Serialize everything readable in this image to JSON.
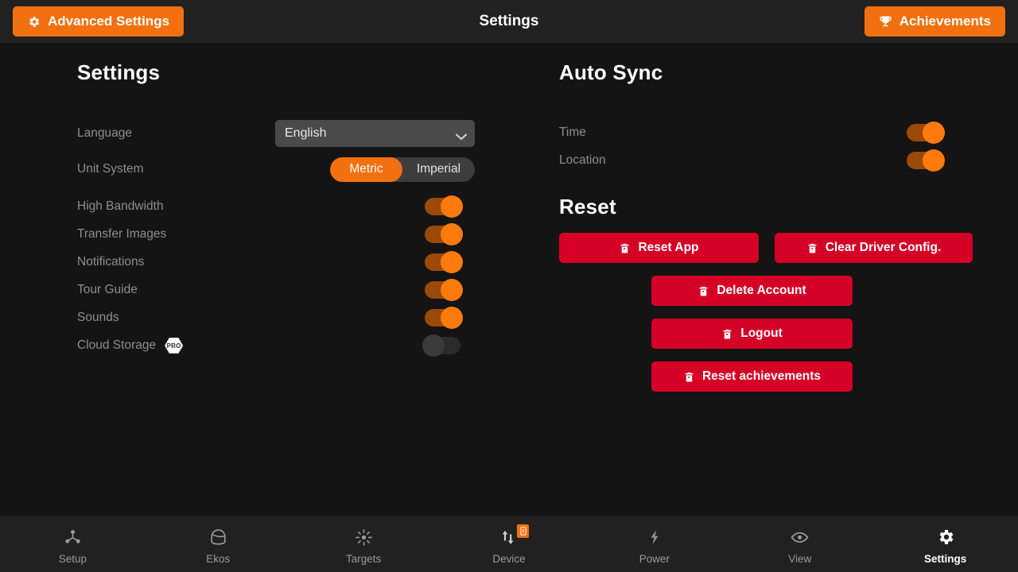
{
  "header": {
    "title": "Settings",
    "advanced_settings_label": "Advanced Settings",
    "advanced_settings_icon": "gear-icon",
    "achievements_label": "Achievements",
    "achievements_icon": "trophy-icon",
    "accent_color": "#f2700f",
    "background": "#212121"
  },
  "settings_section": {
    "title": "Settings",
    "language": {
      "label": "Language",
      "value": "English",
      "chevron_icon": "chevron-down-icon"
    },
    "unit_system": {
      "label": "Unit System",
      "options": [
        "Metric",
        "Imperial"
      ],
      "selected": "Metric"
    },
    "toggles": [
      {
        "label": "High Bandwidth",
        "state": "on"
      },
      {
        "label": "Transfer Images",
        "state": "on"
      },
      {
        "label": "Notifications",
        "state": "on"
      },
      {
        "label": "Tour Guide",
        "state": "on"
      },
      {
        "label": "Sounds",
        "state": "on"
      },
      {
        "label": "Cloud Storage",
        "state": "off",
        "badge": "PRO"
      }
    ]
  },
  "auto_sync_section": {
    "title": "Auto Sync",
    "toggles": [
      {
        "label": "Time",
        "state": "on"
      },
      {
        "label": "Location",
        "state": "on"
      }
    ]
  },
  "reset_section": {
    "title": "Reset",
    "button_color": "#d40025",
    "buttons": [
      {
        "label": "Reset App",
        "icon": "trash-icon"
      },
      {
        "label": "Clear Driver Config.",
        "icon": "trash-icon"
      },
      {
        "label": "Delete Account",
        "icon": "trash-icon"
      },
      {
        "label": "Logout",
        "icon": "trash-icon"
      },
      {
        "label": "Reset achievements",
        "icon": "trash-icon"
      }
    ]
  },
  "navbar": {
    "items": [
      {
        "label": "Setup",
        "icon": "hub-node-icon",
        "active": false
      },
      {
        "label": "Ekos",
        "icon": "observatory-dome-icon",
        "active": false
      },
      {
        "label": "Targets",
        "icon": "starburst-icon",
        "active": false
      },
      {
        "label": "Device",
        "icon": "transfer-arrows-icon",
        "active": false,
        "badge": true
      },
      {
        "label": "Power",
        "icon": "lightning-bolt-icon",
        "active": false
      },
      {
        "label": "View",
        "icon": "eye-icon",
        "active": false
      },
      {
        "label": "Settings",
        "icon": "gear-icon",
        "active": true
      }
    ]
  }
}
